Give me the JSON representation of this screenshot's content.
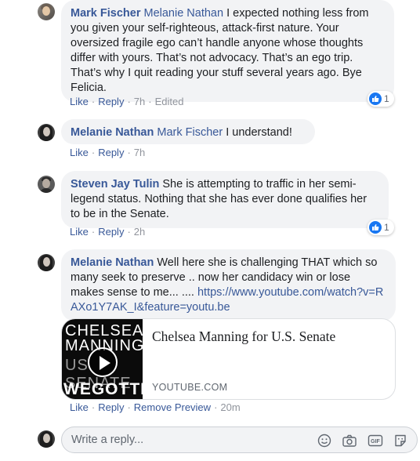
{
  "comments": [
    {
      "author": "Mark Fischer",
      "mention": "Melanie Nathan",
      "text": " I expected nothing less from you given your self-righteous, attack-first nature. Your oversized fragile ego can’t handle anyone whose thoughts differ with yours. That’s not advocacy. That’s an ego trip. That’s why I quit reading your stuff several years ago. Bye Felicia.",
      "like": "Like",
      "reply": "Reply",
      "time": "7h",
      "edited": "Edited",
      "reactions": "1"
    },
    {
      "author": "Melanie Nathan",
      "mention": "Mark Fischer",
      "text": " I understand!",
      "like": "Like",
      "reply": "Reply",
      "time": "7h"
    },
    {
      "author": "Steven Jay Tulin",
      "text": " She is attempting to traffic in her semi-legend status. Nothing that she has ever done qualifies her to be in the Senate.",
      "like": "Like",
      "reply": "Reply",
      "time": "2h",
      "reactions": "1"
    },
    {
      "author": "Melanie Nathan",
      "text": " Well here she is challenging THAT which so many seek to preserve .. now her candidacy win or lose makes sense to me... .... ",
      "link": "https://www.youtube.com/watch?v=RAXo1Y7AK_I&feature=youtu.be",
      "like": "Like",
      "reply": "Reply",
      "remove_preview": "Remove Preview",
      "time": "20m"
    }
  ],
  "preview": {
    "title": "Chelsea Manning for U.S. Senate",
    "domain": "YOUTUBE.COM",
    "thumb_line1": "CHELSEA",
    "thumb_line2": "MANNING",
    "thumb_line3": "US SENATE",
    "thumb_line4": "WEGOTTHI"
  },
  "composer": {
    "placeholder": "Write a reply...",
    "icons": [
      "emoji-icon",
      "camera-icon",
      "gif-icon",
      "sticker-icon"
    ]
  },
  "colors": {
    "link": "#385898",
    "bubble": "#f2f3f5",
    "meta": "#90949c",
    "like_badge": "#1877f2"
  }
}
